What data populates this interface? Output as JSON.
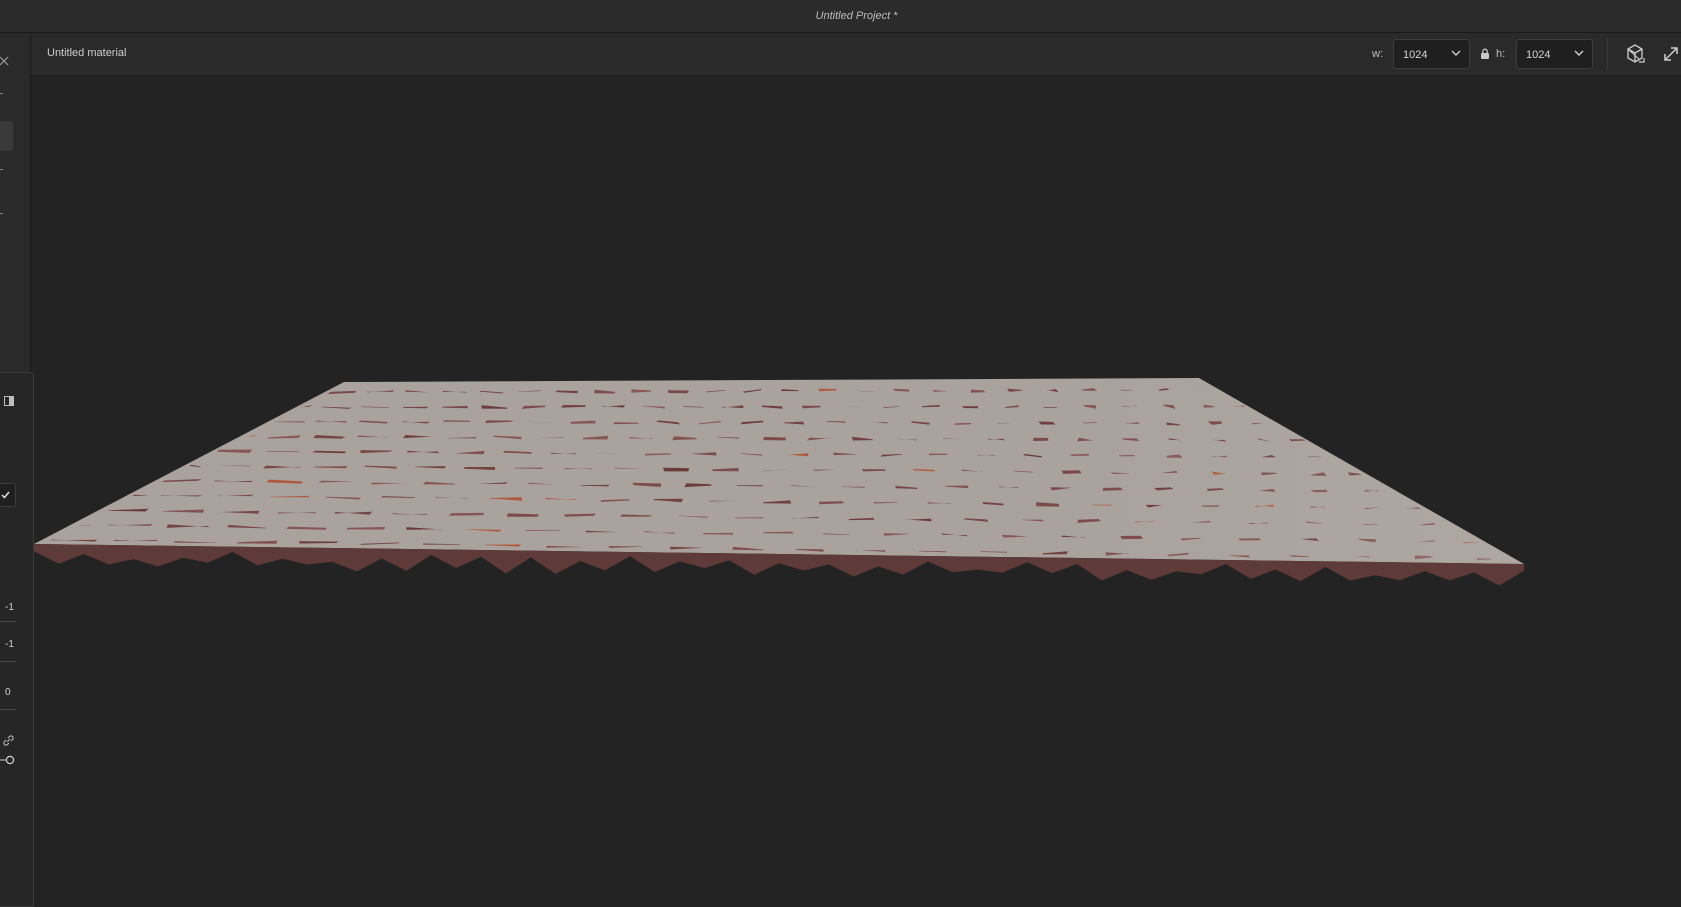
{
  "app": {
    "project_title": "Untitled Project *"
  },
  "toolbar": {
    "material_name": "Untitled material",
    "width_label": "w:",
    "width_value": "1024",
    "height_label": "h:",
    "height_value": "1024"
  },
  "left_panel": {
    "values": [
      "-1",
      "-1",
      "0"
    ]
  },
  "viewport": {
    "content": "3d-brick-material-preview",
    "colors": {
      "background": "#232323",
      "brick": "#7a4a48",
      "brick_orange": "#b0583e",
      "mortar": "#a9a29d"
    }
  }
}
